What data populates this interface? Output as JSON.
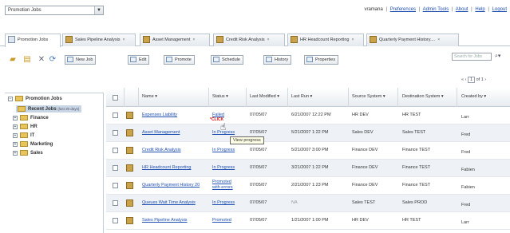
{
  "job_select": {
    "value": "Promotion Jobs"
  },
  "top_links": {
    "user": "vramana",
    "items": [
      "Preferences",
      "Admin Tools",
      "About",
      "Help",
      "Logout"
    ]
  },
  "tabs": [
    {
      "label": "Promotion Jobs"
    },
    {
      "label": "Sales Pipeline Analysis"
    },
    {
      "label": "Asset Management"
    },
    {
      "label": "Credit Risk Analysis"
    },
    {
      "label": "HR Headcount Reporting"
    },
    {
      "label": "Quarterly Payment History...."
    }
  ],
  "toolbar": {
    "new_job": "New Job",
    "edit": "Edit",
    "promote": "Promote",
    "schedule": "Schedule",
    "history": "History",
    "properties": "Properties"
  },
  "search": {
    "placeholder": "Search for Jobs"
  },
  "pager": {
    "page": "1",
    "suffix": "of 1"
  },
  "tree": {
    "root": "Promotion Jobs",
    "recent": "Recent Jobs",
    "recent_note": "(last 30 days)",
    "items": [
      "Finance",
      "HR",
      "IT",
      "Marketing",
      "Sales"
    ]
  },
  "grid": {
    "headers": [
      "Name",
      "Status",
      "Last Modified",
      "Last Run",
      "Source System",
      "Destination System",
      "Created by"
    ],
    "rows": [
      {
        "name": "Expenses Liability",
        "status": "Failed",
        "modified": "07/05/07",
        "lastrun": "6/21/2007 12:22 PM",
        "source": "HR DEV",
        "dest": "HR TEST",
        "by": "Larr"
      },
      {
        "name": "Asset Management",
        "status": "In Progress",
        "modified": "07/05/07",
        "lastrun": "5/21/2007 1:22 PM",
        "source": "Sales DEV",
        "dest": "Sales TEST",
        "by": "Fred"
      },
      {
        "name": "Credit Risk Analysis",
        "status": "In Progress",
        "modified": "07/05/07",
        "lastrun": "5/21/2007 3:00 PM",
        "source": "Finance DEV",
        "dest": "Finance TEST",
        "by": "Fred"
      },
      {
        "name": "HR Headcount Reporting",
        "status": "In Progress",
        "modified": "07/05/07",
        "lastrun": "3/21/2007 1:22 PM",
        "source": "Finance DEV",
        "dest": "Finance TEST",
        "by": "Fabien"
      },
      {
        "name": "Quarterly Payment History 20",
        "status": "Promoted",
        "status2": "with errors",
        "modified": "07/05/07",
        "lastrun": "2/21/2007 1:23 PM",
        "source": "Finance DEV",
        "dest": "Finance TEST",
        "by": "Fabien"
      },
      {
        "name": "Queues Wait Time Analysis",
        "status": "In Progress",
        "modified": "07/05/07",
        "lastrun": "NA",
        "source": "Sales TEST",
        "dest": "Sales PROD",
        "by": "Fred"
      },
      {
        "name": "Sales Pipeline Analysis",
        "status": "Promoted",
        "modified": "07/05/07",
        "lastrun": "1/21/2007 1:00 PM",
        "source": "HR DEV",
        "dest": "HR TEST",
        "by": "Larr"
      }
    ]
  },
  "overlay": {
    "click_label": "*CLICK",
    "tooltip": "View progress"
  }
}
